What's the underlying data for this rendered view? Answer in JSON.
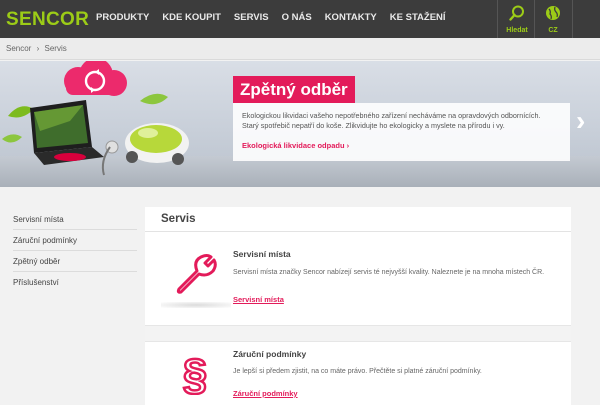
{
  "header": {
    "logo": "SENCOR",
    "nav": [
      "PRODUKTY",
      "KDE KOUPIT",
      "SERVIS",
      "O NÁS",
      "KONTAKTY",
      "KE STAŽENÍ"
    ],
    "search_label": "Hledat",
    "lang_label": "CZ"
  },
  "breadcrumb": [
    "Sencor",
    "›",
    "Servis"
  ],
  "hero": {
    "title": "Zpětný odběr",
    "text_line1": "Ekologickou likvidaci vašeho nepotřebného zařízení necháváme na opravdových odbornících.",
    "text_line2": "Starý spotřebič nepatří do koše. Zlikvidujte ho ekologicky a myslete na přírodu i vy.",
    "link": "Ekologická likvidace odpadu",
    "arrow": "›",
    "link_arrow": "›"
  },
  "sidebar": {
    "items": [
      "Servisní místa",
      "Záruční podmínky",
      "Zpětný odběr",
      "Příslušenství"
    ]
  },
  "content": {
    "title": "Servis",
    "blocks": [
      {
        "title": "Servisní místa",
        "desc": "Servisní místa značky Sencor nabízejí servis té nejvyšší kvality. Naleznete je na mnoha místech ČR.",
        "link": "Servisní místa"
      },
      {
        "title": "Záruční podmínky",
        "desc": "Je lepší si předem zjistit, na co máte právo. Přečtěte si platné záruční podmínky.",
        "link": "Záruční podmínky"
      }
    ]
  },
  "colors": {
    "brand_green": "#9ccc17",
    "accent_pink": "#e31b5a",
    "nav_bg": "#3c3c3c"
  },
  "icons": [
    "search-icon",
    "globe-icon",
    "recycle-icon",
    "wrench-icon",
    "paragraph-icon",
    "chevron-right-icon"
  ]
}
